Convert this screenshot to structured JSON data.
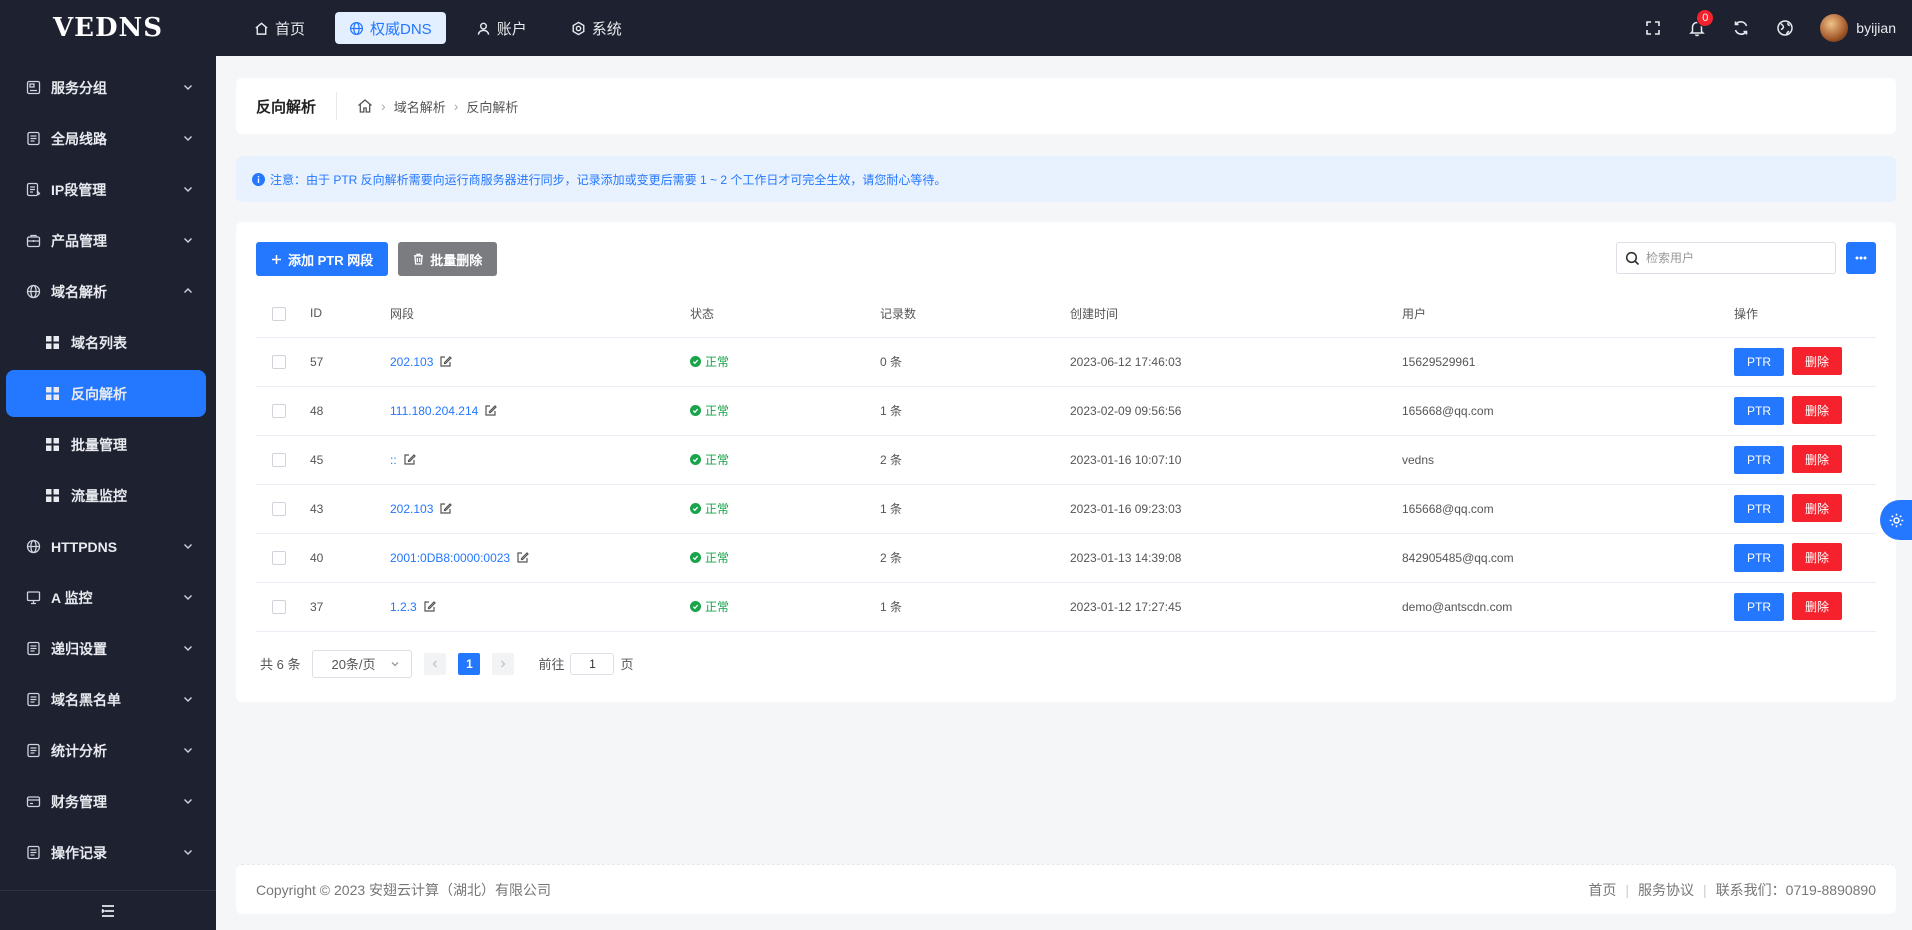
{
  "app": {
    "logo": "VEDNS"
  },
  "topnav": [
    {
      "label": "首页",
      "icon": "home-icon",
      "active": false
    },
    {
      "label": "权威DNS",
      "icon": "globe-icon",
      "active": true
    },
    {
      "label": "账户",
      "icon": "user-icon",
      "active": false
    },
    {
      "label": "系统",
      "icon": "settings-icon",
      "active": false
    }
  ],
  "header": {
    "notification_count": "0",
    "username": "byijian"
  },
  "sidebar": {
    "items": [
      {
        "label": "服务分组"
      },
      {
        "label": "全局线路"
      },
      {
        "label": "IP段管理"
      },
      {
        "label": "产品管理"
      },
      {
        "label": "域名解析",
        "expanded": true,
        "children": [
          {
            "label": "域名列表"
          },
          {
            "label": "反向解析",
            "active": true
          },
          {
            "label": "批量管理"
          },
          {
            "label": "流量监控"
          }
        ]
      },
      {
        "label": "HTTPDNS"
      },
      {
        "label": "A 监控"
      },
      {
        "label": "递归设置"
      },
      {
        "label": "域名黑名单"
      },
      {
        "label": "统计分析"
      },
      {
        "label": "财务管理"
      },
      {
        "label": "操作记录"
      }
    ]
  },
  "page": {
    "title": "反向解析",
    "breadcrumb": [
      "域名解析",
      "反向解析"
    ],
    "notice": "注意：由于 PTR 反向解析需要向运行商服务器进行同步，记录添加或变更后需要 1 ~ 2 个工作日才可完全生效，请您耐心等待。"
  },
  "toolbar": {
    "add_label": "添加 PTR 网段",
    "batch_delete_label": "批量删除",
    "search_placeholder": "检索用户"
  },
  "table": {
    "columns": [
      "ID",
      "网段",
      "状态",
      "记录数",
      "创建时间",
      "用户",
      "操作"
    ],
    "rows": [
      {
        "id": "57",
        "segment": "202.103",
        "status": "正常",
        "records": "0 条",
        "created": "2023-06-12 17:46:03",
        "user": "15629529961"
      },
      {
        "id": "48",
        "segment": "111.180.204.214",
        "status": "正常",
        "records": "1 条",
        "created": "2023-02-09 09:56:56",
        "user": "165668@qq.com"
      },
      {
        "id": "45",
        "segment": "::",
        "status": "正常",
        "records": "2 条",
        "created": "2023-01-16 10:07:10",
        "user": "vedns"
      },
      {
        "id": "43",
        "segment": "202.103",
        "status": "正常",
        "records": "1 条",
        "created": "2023-01-16 09:23:03",
        "user": "165668@qq.com"
      },
      {
        "id": "40",
        "segment": "2001:0DB8:0000:0023",
        "status": "正常",
        "records": "2 条",
        "created": "2023-01-13 14:39:08",
        "user": "842905485@qq.com"
      },
      {
        "id": "37",
        "segment": "1.2.3",
        "status": "正常",
        "records": "1 条",
        "created": "2023-01-12 17:27:45",
        "user": "demo@antscdn.com"
      }
    ],
    "ptr_label": "PTR",
    "delete_label": "删除"
  },
  "pagination": {
    "total": "共 6 条",
    "page_size": "20条/页",
    "current": "1",
    "goto_prefix": "前往",
    "goto_value": "1",
    "goto_suffix": "页"
  },
  "footer": {
    "copyright": "Copyright © 2023 安翅云计算（湖北）有限公司",
    "links": [
      "首页",
      "服务协议",
      "联系我们：0719-8890890"
    ]
  },
  "colors": {
    "primary": "#2477ff",
    "danger": "#f5222d",
    "success": "#19a34a",
    "sidebar": "#1e2230"
  }
}
